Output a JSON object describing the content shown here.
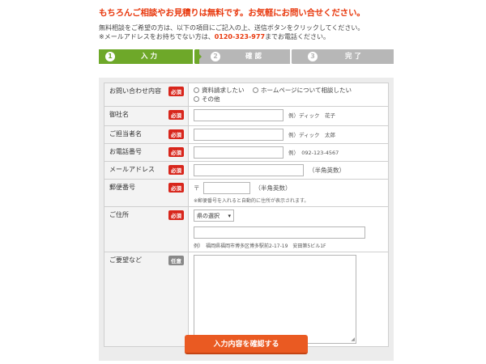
{
  "header": {
    "headline": "もちろんご相談やお見積りは無料です。お気軽にお問い合せください。",
    "intro_line1": "無料相談をご希望の方は、以下の項目にご記入の上、送信ボタンをクリックしてください。",
    "intro_line2_prefix": "※メールアドレスをお持ちでない方は、",
    "intro_phone": "0120-323-977",
    "intro_line2_suffix": "までお電話ください。"
  },
  "steps": [
    {
      "num": "1",
      "label": "入 力",
      "state": "active",
      "color": "#6ea829"
    },
    {
      "num": "2",
      "label": "確 認",
      "state": "inactive",
      "color": "#b7b7b7"
    },
    {
      "num": "3",
      "label": "完 了",
      "state": "inactive",
      "color": "#b7b7b7"
    }
  ],
  "form": {
    "required_badge": "必須",
    "optional_badge": "任意",
    "inquiry": {
      "label": "お問い合わせ内容",
      "options": [
        "資料請求したい",
        "ホームページについて相談したい",
        "その他"
      ]
    },
    "company": {
      "label": "御社名",
      "value": "",
      "example": "例）ディック　花子"
    },
    "contact_person": {
      "label": "ご担当者名",
      "value": "",
      "example": "例）ディック　太郎"
    },
    "phone": {
      "label": "お電話番号",
      "value": "",
      "example": "例）　092-123-4567"
    },
    "email": {
      "label": "メールアドレス",
      "value": "",
      "suffix": "（半角英数）"
    },
    "postal": {
      "label": "郵便番号",
      "prefix": "〒",
      "value": "",
      "suffix": "（半角英数）",
      "note": "※郵便番号を入れると自動的に住所が表示されます。"
    },
    "address": {
      "label": "ご住所",
      "select_value": "県の選択",
      "value": "",
      "example": "例）　福岡県福岡市博多区博多駅前2-17-19　安田第5ビル1F"
    },
    "request": {
      "label": "ご要望など",
      "value": ""
    }
  },
  "submit": {
    "label": "入力内容を確認する",
    "color": "#ea5a22"
  },
  "colors": {
    "accent": "#e8380d",
    "required": "#d8261c",
    "optional": "#888888"
  }
}
